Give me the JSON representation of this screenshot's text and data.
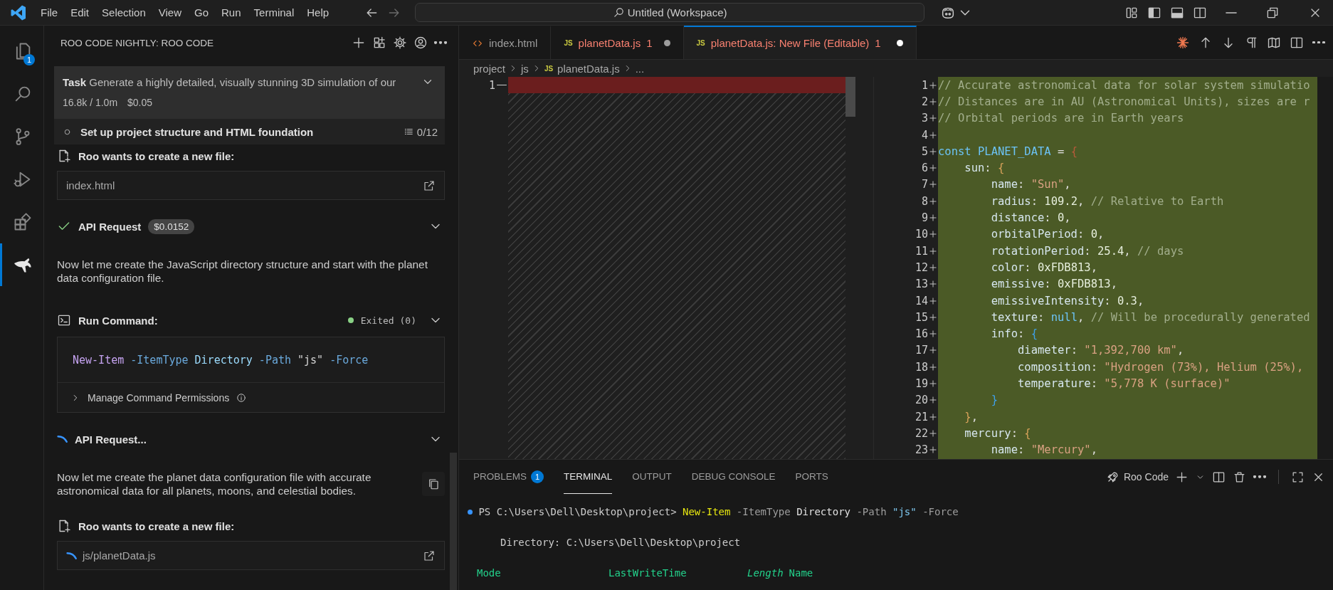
{
  "title_bar": {
    "menu": [
      "File",
      "Edit",
      "Selection",
      "View",
      "Go",
      "Run",
      "Terminal",
      "Help"
    ],
    "command_center": "Untitled (Workspace)"
  },
  "activity_bar": {
    "items": [
      {
        "kind": "explorer",
        "selected": false,
        "badge": "1"
      },
      {
        "kind": "search",
        "selected": false
      },
      {
        "kind": "source-control",
        "selected": false
      },
      {
        "kind": "run-debug",
        "selected": false
      },
      {
        "kind": "extensions",
        "selected": false
      },
      {
        "kind": "roo",
        "selected": true
      }
    ]
  },
  "sidebar": {
    "title": "ROO CODE NIGHTLY: ROO CODE",
    "task": {
      "label": "Task",
      "text": "Generate a highly detailed, visually stunning 3D simulation of our",
      "tokens": "16.8k / 1.0m",
      "cost": "$0.05"
    },
    "todo": {
      "text": "Set up project structure and HTML foundation",
      "done": false,
      "count": "0/12"
    },
    "messages": [
      {
        "kind": "file_request",
        "title": "Roo wants to create a new file:",
        "path": "index.html",
        "loading": false
      },
      {
        "kind": "api_request",
        "title": "API Request",
        "cost": "$0.0152",
        "done": true
      },
      {
        "kind": "text",
        "text": "Now let me create the JavaScript directory structure and start with the planet data configuration file.",
        "copyable": false
      },
      {
        "kind": "command",
        "title": "Run Command:",
        "status": "Exited (0)",
        "command": [
          {
            "kind": "cmdlet",
            "text": "New-Item"
          },
          {
            "kind": "param",
            "text": "-ItemType"
          },
          {
            "kind": "value",
            "text": "Directory"
          },
          {
            "kind": "param",
            "text": "-Path"
          },
          {
            "kind": "string",
            "text": "\"js\""
          },
          {
            "kind": "param",
            "text": "-Force"
          }
        ],
        "permissions": "Manage Command Permissions"
      },
      {
        "kind": "api_request",
        "title": "API Request...",
        "done": false
      },
      {
        "kind": "text",
        "text": "Now let me create the planet data configuration file with accurate astronomical data for all planets, moons, and celestial bodies.",
        "copyable": true
      },
      {
        "kind": "file_request",
        "title": "Roo wants to create a new file:",
        "path": "js/planetData.js",
        "loading": true
      }
    ]
  },
  "editor": {
    "tabs": [
      {
        "label": "index.html",
        "kind": "html",
        "selected": false,
        "error": false,
        "modified": false
      },
      {
        "label": "planetData.js",
        "kind": "js",
        "badge": "JS",
        "count": "1",
        "selected": false,
        "error": true,
        "modified": true
      },
      {
        "label": "planetData.js: New File (Editable)",
        "kind": "js",
        "badge": "JS",
        "count": "1",
        "selected": true,
        "error": true,
        "modified": true
      }
    ],
    "breadcrumb": [
      {
        "text": "project"
      },
      {
        "text": "js"
      },
      {
        "text": "planetData.js",
        "badge": "JS"
      },
      {
        "text": "..."
      }
    ],
    "original": {
      "lines": [
        {
          "n": "1",
          "removed": true
        }
      ]
    },
    "modified": {
      "lines": [
        {
          "n": "1",
          "added": true,
          "tokens": [
            {
              "kind": "comment",
              "text": "// Accurate astronomical data for solar system simulatio"
            }
          ]
        },
        {
          "n": "2",
          "added": true,
          "tokens": [
            {
              "kind": "comment",
              "text": "// Distances are in AU (Astronomical Units), sizes are r"
            }
          ]
        },
        {
          "n": "3",
          "added": true,
          "tokens": [
            {
              "kind": "comment",
              "text": "// Orbital periods are in Earth years"
            }
          ]
        },
        {
          "n": "4",
          "added": true
        },
        {
          "n": "5",
          "added": true,
          "tokens": [
            {
              "kind": "keyword",
              "text": "const"
            },
            {
              "kind": "const",
              "text": " PLANET_DATA"
            },
            {
              "kind": "punct",
              "text": " = "
            },
            {
              "kind": "b1",
              "text": "{"
            }
          ]
        },
        {
          "n": "6",
          "added": true,
          "tokens": [
            {
              "kind": "key",
              "text": "    sun"
            },
            {
              "kind": "punct",
              "text": ": "
            },
            {
              "kind": "b2",
              "text": "{"
            }
          ]
        },
        {
          "n": "7",
          "added": true,
          "tokens": [
            {
              "kind": "key",
              "text": "        name"
            },
            {
              "kind": "punct",
              "text": ": "
            },
            {
              "kind": "string",
              "text": "\"Sun\""
            },
            {
              "kind": "punct",
              "text": ","
            }
          ]
        },
        {
          "n": "8",
          "added": true,
          "tokens": [
            {
              "kind": "key",
              "text": "        radius"
            },
            {
              "kind": "punct",
              "text": ": "
            },
            {
              "kind": "number",
              "text": "109.2"
            },
            {
              "kind": "punct",
              "text": ", "
            },
            {
              "kind": "comment",
              "text": "// Relative to Earth"
            }
          ]
        },
        {
          "n": "9",
          "added": true,
          "tokens": [
            {
              "kind": "key",
              "text": "        distance"
            },
            {
              "kind": "punct",
              "text": ": "
            },
            {
              "kind": "number",
              "text": "0"
            },
            {
              "kind": "punct",
              "text": ","
            }
          ]
        },
        {
          "n": "10",
          "added": true,
          "tokens": [
            {
              "kind": "key",
              "text": "        orbitalPeriod"
            },
            {
              "kind": "punct",
              "text": ": "
            },
            {
              "kind": "number",
              "text": "0"
            },
            {
              "kind": "punct",
              "text": ","
            }
          ]
        },
        {
          "n": "11",
          "added": true,
          "tokens": [
            {
              "kind": "key",
              "text": "        rotationPeriod"
            },
            {
              "kind": "punct",
              "text": ": "
            },
            {
              "kind": "number",
              "text": "25.4"
            },
            {
              "kind": "punct",
              "text": ", "
            },
            {
              "kind": "comment",
              "text": "// days"
            }
          ]
        },
        {
          "n": "12",
          "added": true,
          "tokens": [
            {
              "kind": "key",
              "text": "        color"
            },
            {
              "kind": "punct",
              "text": ": "
            },
            {
              "kind": "number",
              "text": "0xFDB813"
            },
            {
              "kind": "punct",
              "text": ","
            }
          ]
        },
        {
          "n": "13",
          "added": true,
          "tokens": [
            {
              "kind": "key",
              "text": "        emissive"
            },
            {
              "kind": "punct",
              "text": ": "
            },
            {
              "kind": "number",
              "text": "0xFDB813"
            },
            {
              "kind": "punct",
              "text": ","
            }
          ]
        },
        {
          "n": "14",
          "added": true,
          "tokens": [
            {
              "kind": "key",
              "text": "        emissiveIntensity"
            },
            {
              "kind": "punct",
              "text": ": "
            },
            {
              "kind": "number",
              "text": "0.3"
            },
            {
              "kind": "punct",
              "text": ","
            }
          ]
        },
        {
          "n": "15",
          "added": true,
          "tokens": [
            {
              "kind": "key",
              "text": "        texture"
            },
            {
              "kind": "punct",
              "text": ": "
            },
            {
              "kind": "null",
              "text": "null"
            },
            {
              "kind": "punct",
              "text": ", "
            },
            {
              "kind": "comment",
              "text": "// Will be procedurally generated"
            }
          ]
        },
        {
          "n": "16",
          "added": true,
          "tokens": [
            {
              "kind": "key",
              "text": "        info"
            },
            {
              "kind": "punct",
              "text": ": "
            },
            {
              "kind": "b3",
              "text": "{"
            }
          ]
        },
        {
          "n": "17",
          "added": true,
          "tokens": [
            {
              "kind": "key",
              "text": "            diameter"
            },
            {
              "kind": "punct",
              "text": ": "
            },
            {
              "kind": "string",
              "text": "\"1,392,700 km\""
            },
            {
              "kind": "punct",
              "text": ","
            }
          ]
        },
        {
          "n": "18",
          "added": true,
          "tokens": [
            {
              "kind": "key",
              "text": "            composition"
            },
            {
              "kind": "punct",
              "text": ": "
            },
            {
              "kind": "string",
              "text": "\"Hydrogen (73%), Helium (25%),"
            }
          ]
        },
        {
          "n": "19",
          "added": true,
          "tokens": [
            {
              "kind": "key",
              "text": "            temperature"
            },
            {
              "kind": "punct",
              "text": ": "
            },
            {
              "kind": "string",
              "text": "\"5,778 K (surface)\""
            }
          ]
        },
        {
          "n": "20",
          "added": true,
          "tokens": [
            {
              "kind": "b3",
              "text": "        }"
            }
          ]
        },
        {
          "n": "21",
          "added": true,
          "tokens": [
            {
              "kind": "b2",
              "text": "    }"
            },
            {
              "kind": "punct",
              "text": ","
            }
          ]
        },
        {
          "n": "22",
          "added": true,
          "tokens": [
            {
              "kind": "key",
              "text": "    mercury"
            },
            {
              "kind": "punct",
              "text": ": "
            },
            {
              "kind": "b2",
              "text": "{"
            }
          ]
        },
        {
          "n": "23",
          "added": true,
          "tokens": [
            {
              "kind": "key",
              "text": "        name"
            },
            {
              "kind": "punct",
              "text": ": "
            },
            {
              "kind": "string",
              "text": "\"Mercury\""
            },
            {
              "kind": "punct",
              "text": ","
            }
          ]
        }
      ]
    }
  },
  "panel": {
    "tabs": [
      {
        "label": "PROBLEMS",
        "badge": "1",
        "selected": false
      },
      {
        "label": "TERMINAL",
        "selected": true
      },
      {
        "label": "OUTPUT",
        "selected": false
      },
      {
        "label": "DEBUG CONSOLE",
        "selected": false
      },
      {
        "label": "PORTS",
        "selected": false
      }
    ],
    "terminal_name": "Roo Code",
    "lines": [
      {
        "kind": "command",
        "tokens": [
          {
            "kind": "prompt",
            "text": "PS C:\\Users\\Dell\\Desktop\\project>"
          },
          {
            "kind": "cmdlet",
            "text": "New-Item"
          },
          {
            "kind": "param",
            "text": "-ItemType"
          },
          {
            "kind": "value",
            "text": "Directory"
          },
          {
            "kind": "param",
            "text": "-Path"
          },
          {
            "kind": "string",
            "text": "\"js\""
          },
          {
            "kind": "param",
            "text": "-Force"
          }
        ]
      },
      {
        "kind": "output",
        "text": "Directory: C:\\Users\\Dell\\Desktop\\project"
      },
      {
        "kind": "columns",
        "cells": [
          {
            "text": "Mode",
            "italic": false
          },
          {
            "text": "LastWriteTime",
            "italic": false
          },
          {
            "text": "Length",
            "italic": true
          },
          {
            "text": "Name",
            "italic": false
          }
        ]
      }
    ]
  }
}
